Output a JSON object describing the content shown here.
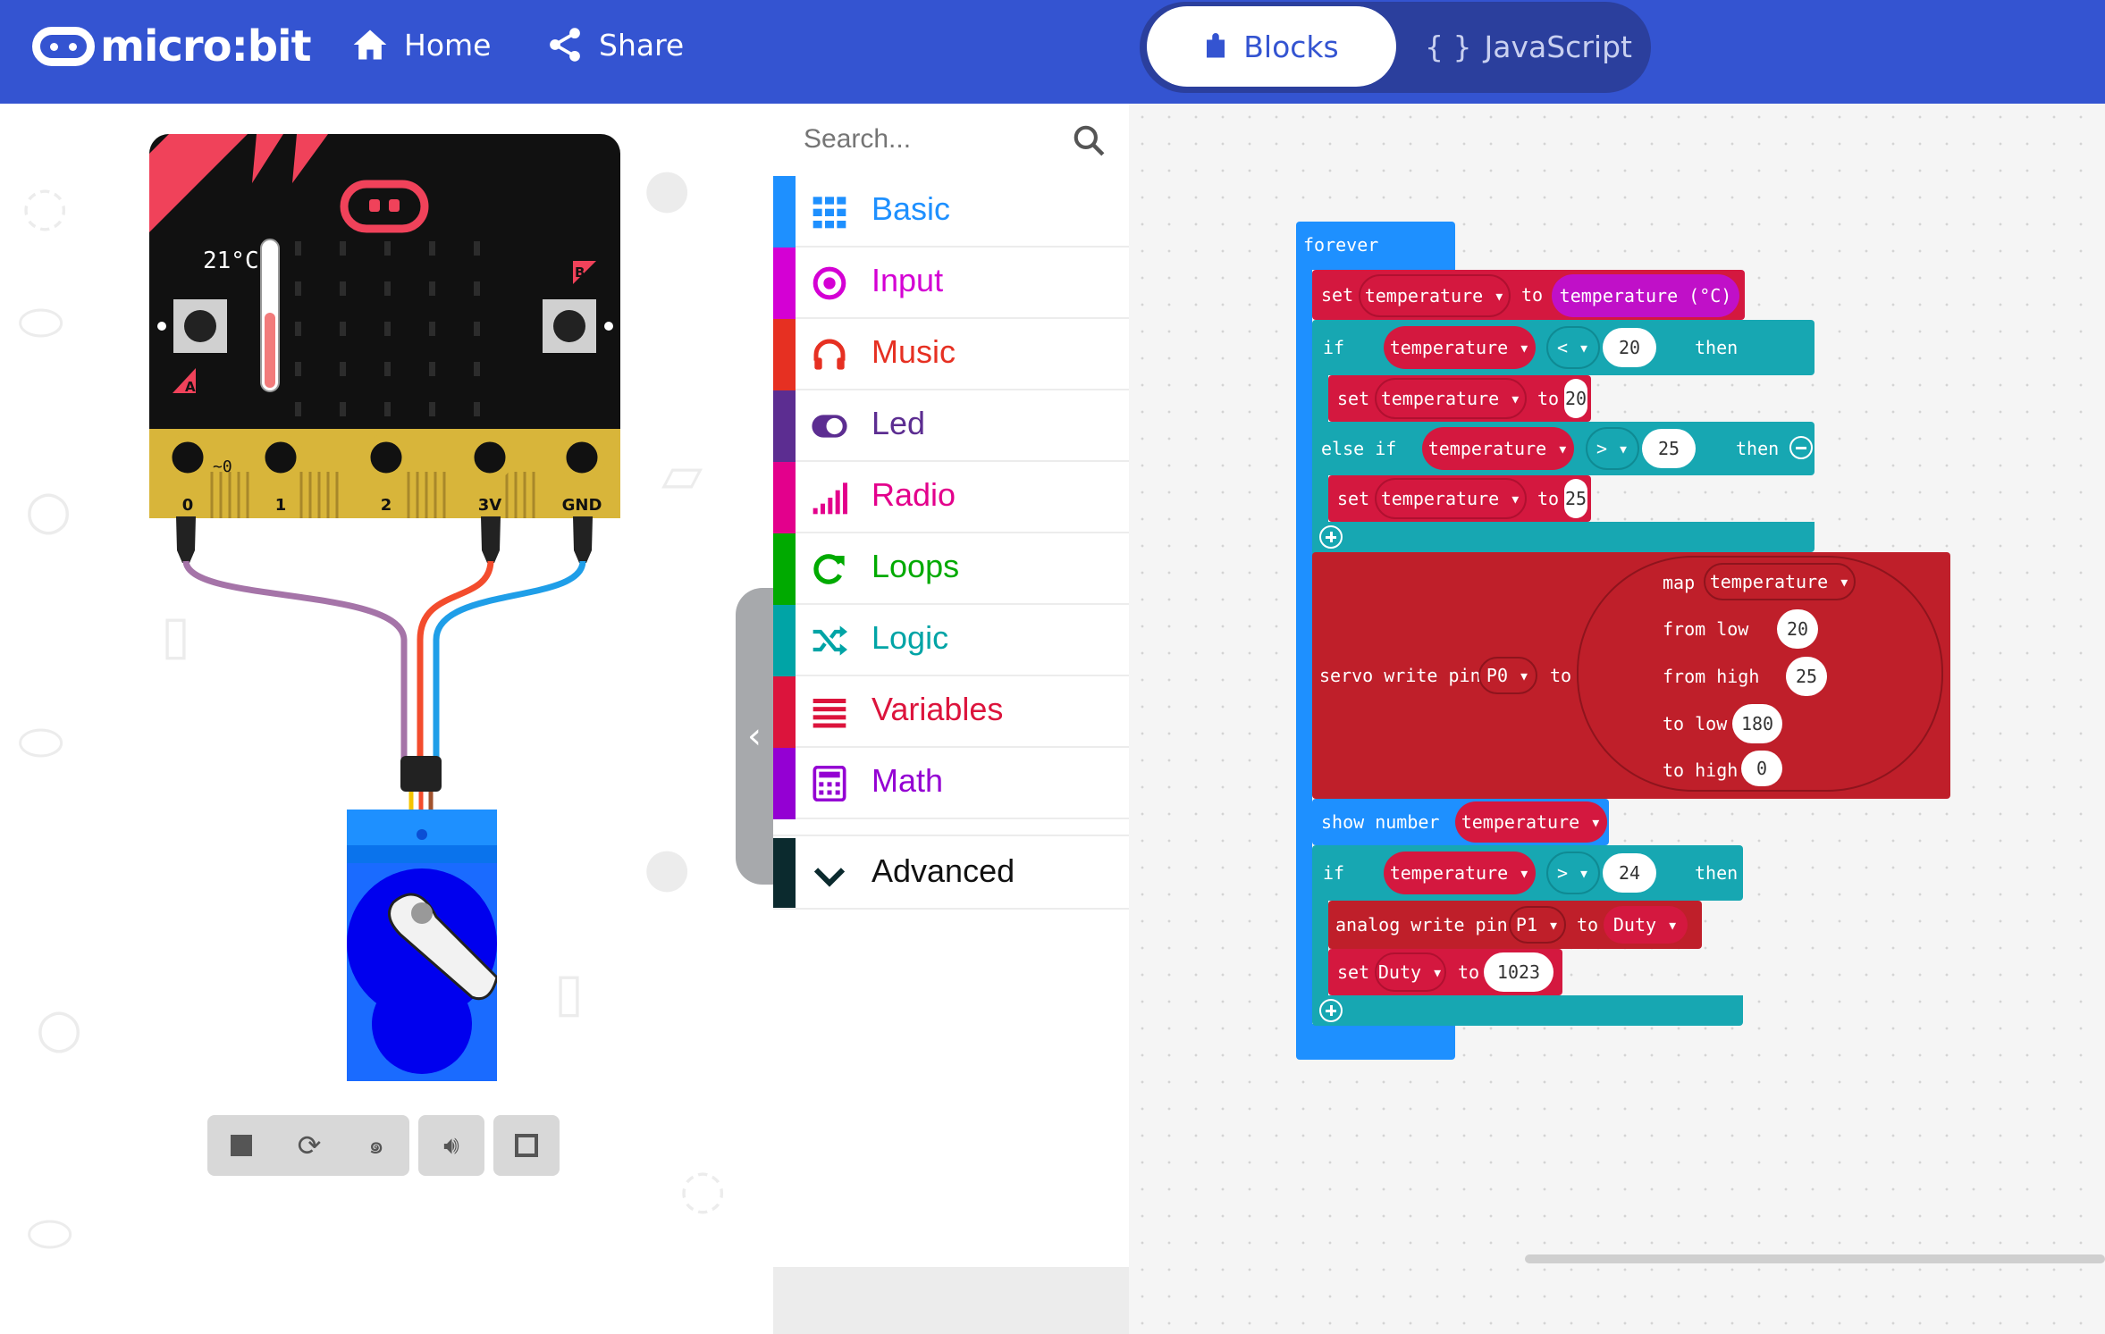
{
  "topbar": {
    "logo_text": "micro:bit",
    "home_label": "Home",
    "share_label": "Share",
    "blocks_label": "Blocks",
    "js_icon": "{ }",
    "js_label": "JavaScript"
  },
  "simulator": {
    "temperature_readout": "21°C",
    "pins": [
      "0",
      "1",
      "2",
      "3V",
      "GND"
    ],
    "pin0_mode": "~0",
    "button_a": "A",
    "button_b": "B",
    "controls": [
      "stop-icon",
      "restart-icon",
      "slow-mo-icon",
      "mute-icon",
      "fullscreen-icon"
    ]
  },
  "toolbox": {
    "search_placeholder": "Search...",
    "categories": [
      {
        "label": "Basic",
        "color": "#1e90ff",
        "icon": "grid-icon"
      },
      {
        "label": "Input",
        "color": "#d400d4",
        "icon": "target-icon"
      },
      {
        "label": "Music",
        "color": "#e63022",
        "icon": "headphones-icon"
      },
      {
        "label": "Led",
        "color": "#5c2d91",
        "icon": "toggle-icon"
      },
      {
        "label": "Radio",
        "color": "#e3008c",
        "icon": "signal-bars-icon"
      },
      {
        "label": "Loops",
        "color": "#00aa00",
        "icon": "loop-arrow-icon"
      },
      {
        "label": "Logic",
        "color": "#00a4a6",
        "icon": "shuffle-icon"
      },
      {
        "label": "Variables",
        "color": "#dc143c",
        "icon": "list-lines-icon"
      },
      {
        "label": "Math",
        "color": "#9400d3",
        "icon": "calculator-icon"
      }
    ],
    "advanced_label": "Advanced"
  },
  "blocks": {
    "forever": "forever",
    "set1": {
      "kw": "set",
      "var": "temperature ▾",
      "to": "to",
      "value": "temperature (°C)"
    },
    "if1": {
      "kw": "if",
      "var": "temperature ▾",
      "op": "< ▾",
      "num": "20",
      "then": "then"
    },
    "set2": {
      "kw": "set",
      "var": "temperature ▾",
      "to": "to",
      "num": "20"
    },
    "elseif": {
      "kw": "else if",
      "var": "temperature ▾",
      "op": "> ▾",
      "num": "25",
      "then": "then"
    },
    "set3": {
      "kw": "set",
      "var": "temperature ▾",
      "to": "to",
      "num": "25"
    },
    "servo": {
      "label": "servo write pin",
      "pin": "P0 ▾",
      "to": "to"
    },
    "map": {
      "kw": "map",
      "var": "temperature ▾",
      "from_low": "from low",
      "from_low_v": "20",
      "from_high": "from high",
      "from_high_v": "25",
      "to_low": "to low",
      "to_low_v": "180",
      "to_high": "to high",
      "to_high_v": "0"
    },
    "show": {
      "label": "show number",
      "var": "temperature ▾"
    },
    "if2": {
      "kw": "if",
      "var": "temperature ▾",
      "op": "> ▾",
      "num": "24",
      "then": "then"
    },
    "analog": {
      "label": "analog write pin",
      "pin": "P1 ▾",
      "to": "to",
      "var": "Duty ▾"
    },
    "set4": {
      "kw": "set",
      "var": "Duty ▾",
      "to": "to",
      "num": "1023"
    }
  }
}
